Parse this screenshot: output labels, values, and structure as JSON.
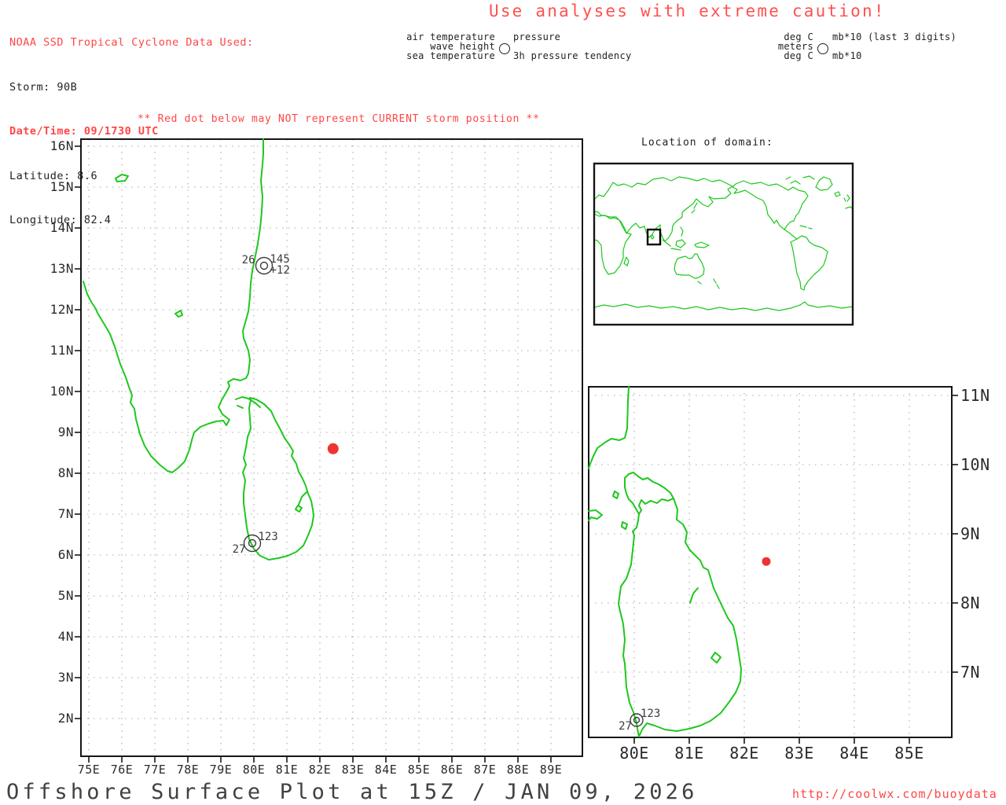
{
  "tc_info": {
    "header": "NOAA SSD Tropical Cyclone Data Used:",
    "storm": "Storm: 90B",
    "datetime": "Date/Time: 09/1730 UTC",
    "latitude": "Latitude: 8.6",
    "longitude": "Longitude: 82.4"
  },
  "caution_banner": "Use analyses with extreme caution!",
  "station_model_legend": {
    "air_temperature": "air temperature",
    "wave_height": "wave height",
    "sea_temperature": "sea temperature",
    "pressure": "pressure",
    "pressure_tendency": "3h pressure tendency"
  },
  "units_legend": {
    "air_temp_units": "deg C",
    "wave_height_units": "meters",
    "sea_temp_units": "deg C",
    "pressure_units": "mb*10 (last 3 digits)",
    "tendency_units": "mb*10"
  },
  "warning": "** Red dot below may NOT represent CURRENT storm position **",
  "main_map": {
    "x_tick_labels": [
      "75E",
      "76E",
      "77E",
      "78E",
      "79E",
      "80E",
      "81E",
      "82E",
      "83E",
      "84E",
      "85E",
      "86E",
      "87E",
      "88E",
      "89E"
    ],
    "y_tick_labels": [
      "16N",
      "15N",
      "14N",
      "13N",
      "12N",
      "11N",
      "10N",
      "9N",
      "8N",
      "7N",
      "6N",
      "5N",
      "4N",
      "3N",
      "2N"
    ],
    "stations": [
      {
        "air_temp": "26",
        "pressure": "145",
        "tendency": "+12"
      },
      {
        "sea_temp": "27",
        "pressure": "123"
      }
    ],
    "storm_position": {
      "lat": 8.6,
      "lon": 82.4
    }
  },
  "inset_map": {
    "title": "Location of domain:"
  },
  "detail_map": {
    "x_tick_labels": [
      "80E",
      "81E",
      "82E",
      "83E",
      "84E",
      "85E"
    ],
    "y_tick_labels": [
      "11N",
      "10N",
      "9N",
      "8N",
      "7N"
    ],
    "stations": [
      {
        "sea_temp": "27",
        "pressure": "123"
      }
    ],
    "storm_position": {
      "lat": 8.6,
      "lon": 82.4
    }
  },
  "footer": {
    "title": "Offshore Surface Plot at 15Z / JAN 09, 2026",
    "url": "http://coolwx.com/buoydata"
  },
  "colors": {
    "accent_red": "#ff4545",
    "coast_green": "#1ec81e",
    "storm_dot_red": "#ee3333",
    "grid_gray": "#a9a9a9"
  }
}
